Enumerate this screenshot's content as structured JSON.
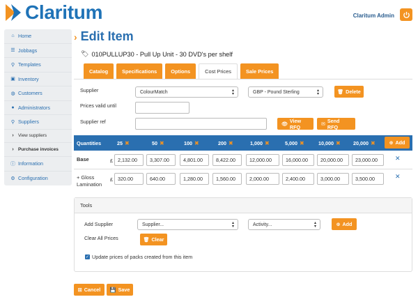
{
  "app": {
    "brand": "Claritum",
    "user": "Claritum Admin"
  },
  "sidebar": {
    "items": [
      {
        "label": "Home",
        "icon": "home-icon"
      },
      {
        "label": "Jobbags",
        "icon": "list-icon"
      },
      {
        "label": "Templates",
        "icon": "paperclip-icon"
      },
      {
        "label": "Inventory",
        "icon": "inbox-icon"
      },
      {
        "label": "Customers",
        "icon": "globe-icon"
      },
      {
        "label": "Administrators",
        "icon": "user-icon"
      },
      {
        "label": "Suppliers",
        "icon": "paperclip-icon"
      },
      {
        "label": "View suppliers",
        "icon": "chevron-right-icon"
      },
      {
        "label": "Purchase invoices",
        "icon": "chevron-right-icon"
      },
      {
        "label": "Information",
        "icon": "info-icon"
      },
      {
        "label": "Configuration",
        "icon": "gear-icon"
      }
    ]
  },
  "page": {
    "title": "Edit Item",
    "item_title": "010PULLUP30 - Pull Up Unit - 30 DVD's per shelf"
  },
  "tabs": [
    "Catalog",
    "Specifications",
    "Options",
    "Cost Prices",
    "Sale Prices"
  ],
  "form": {
    "supplier_label": "Supplier",
    "supplier_value": "ColourMatch",
    "currency_value": "GBP - Pound Sterling",
    "delete_label": "Delete",
    "valid_until_label": "Prices valid until",
    "valid_until_value": "",
    "supplier_ref_label": "Supplier ref",
    "supplier_ref_value": "",
    "view_rfq_label": "View RFQ",
    "send_rfq_label": "Send RFQ"
  },
  "quantities": {
    "header_label": "Quantities",
    "columns": [
      "25",
      "50",
      "100",
      "200",
      "1,000",
      "5,000",
      "10,000",
      "20,000"
    ],
    "add_label": "Add",
    "currency_symbol": "£",
    "rows": [
      {
        "label": "Base",
        "label2": "",
        "values": [
          "2,132.00",
          "3,307.00",
          "4,801.00",
          "8,422.00",
          "12,000.00",
          "16,000.00",
          "20,000.00",
          "23,000.00"
        ]
      },
      {
        "label": "+ Gloss",
        "label2": "Lamination",
        "values": [
          "320.00",
          "640.00",
          "1,280.00",
          "1,560.00",
          "2,000.00",
          "2,400.00",
          "3,000.00",
          "3,500.00"
        ]
      }
    ]
  },
  "tools": {
    "title": "Tools",
    "add_supplier_label": "Add Supplier",
    "supplier_placeholder": "Supplier...",
    "activity_placeholder": "Activity...",
    "add_label": "Add",
    "clear_all_label": "Clear All Prices",
    "clear_label": "Clear",
    "update_packs_label": "Update prices of packs created from this item",
    "update_packs_checked": true
  },
  "footer": {
    "cancel_label": "Cancel",
    "save_label": "Save"
  },
  "colors": {
    "accent": "#f39321",
    "primary": "#2a6fb0"
  }
}
